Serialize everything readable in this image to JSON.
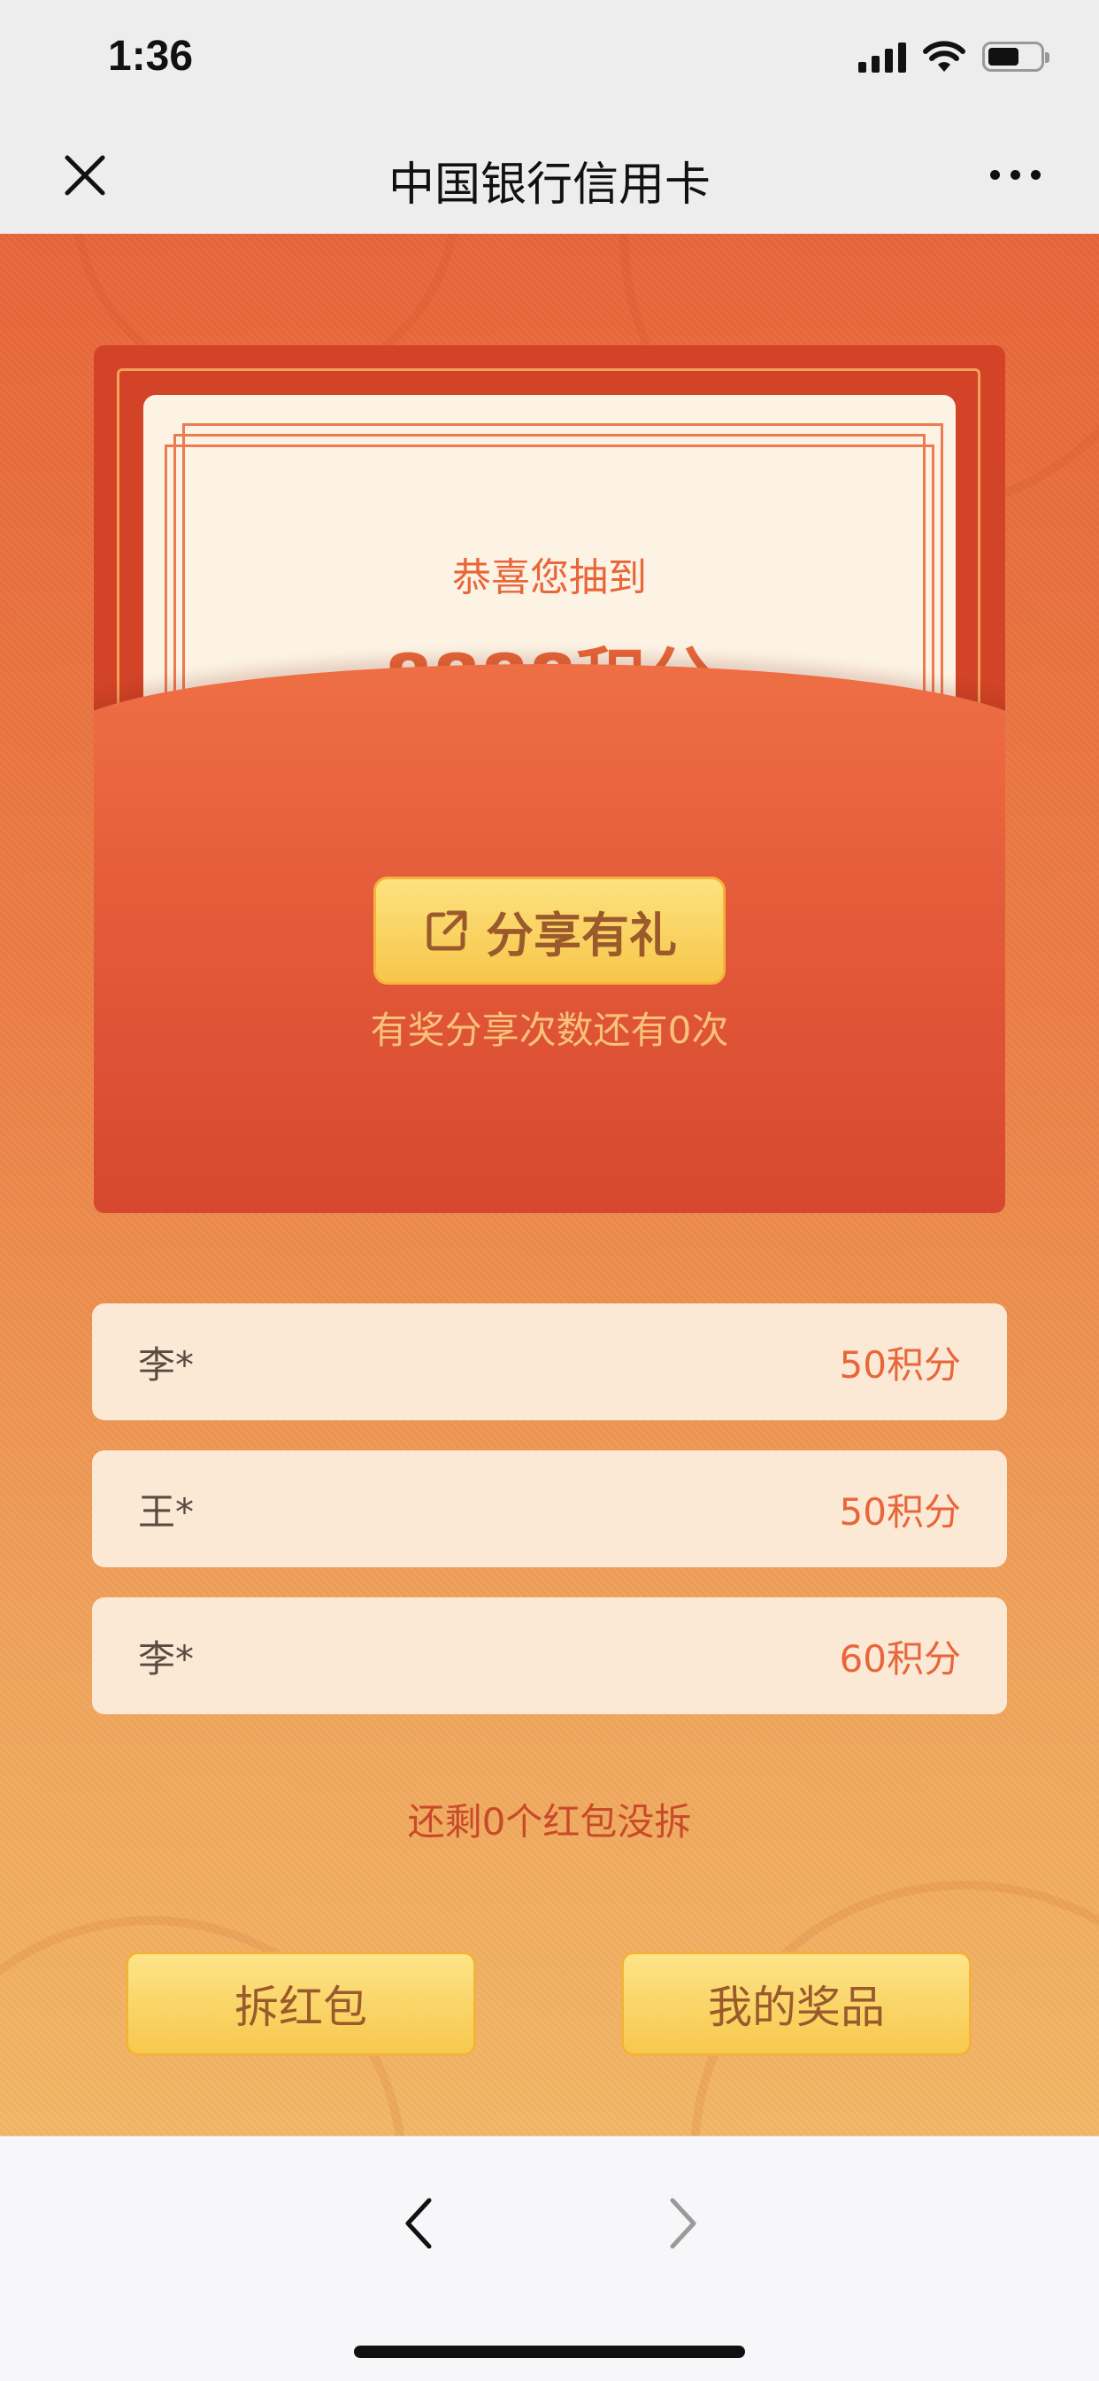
{
  "status_bar": {
    "time": "1:36"
  },
  "nav": {
    "title": "中国银行信用卡",
    "close_icon": "close-icon",
    "more_icon": "more-icon"
  },
  "envelope": {
    "congrats_text": "恭喜您抽到",
    "points_text": "8888积分",
    "share_button_label": "分享有礼",
    "share_remaining_text": "有奖分享次数还有0次"
  },
  "records": [
    {
      "name": "李*",
      "value": "50积分"
    },
    {
      "name": "王*",
      "value": "50积分"
    },
    {
      "name": "李*",
      "value": "60积分"
    }
  ],
  "remaining_text": "还剩0个红包没拆",
  "actions": {
    "open_label": "拆红包",
    "prizes_label": "我的奖品"
  },
  "colors": {
    "accent": "#e8663a",
    "envelope_red": "#d24327",
    "gold": "#f7c64a"
  }
}
